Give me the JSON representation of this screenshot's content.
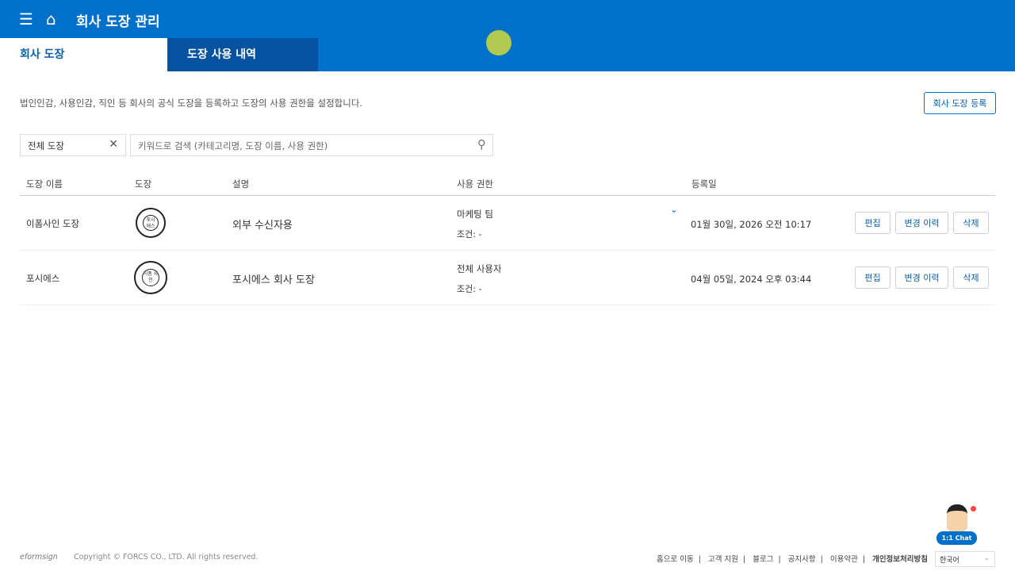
{
  "header": {
    "title": "회사 도장 관리"
  },
  "tabs": [
    {
      "label": "회사 도장"
    },
    {
      "label": "도장 사용 내역"
    }
  ],
  "description": "법인인감, 사용인감, 직인 등 회사의 공식 도장을 등록하고 도장의 사용 권한을 설정합니다.",
  "register_button": "회사 도장 등록",
  "filter": {
    "value": "전체 도장"
  },
  "search": {
    "placeholder": "키워드로 검색 (카테고리명, 도장 이름, 사용 권한)"
  },
  "columns": [
    "도장 이름",
    "도장",
    "설명",
    "사용 권한",
    "등록일"
  ],
  "rows": [
    {
      "name": "이폼사인 도장",
      "seal_text": "포시 에스",
      "description": "외부 수신자용",
      "permission": "마케팅 팀",
      "condition": "조건: -",
      "date": "01월 30일, 2026 오전 10:17"
    },
    {
      "name": "포시에스",
      "seal_text": "이폼 사인",
      "description": "포시에스 회사 도장",
      "permission": "전체 사용자",
      "condition": "조건: -",
      "date": "04월 05일, 2024 오후 03:44"
    }
  ],
  "row_actions": {
    "edit": "편집",
    "history": "변경 이력",
    "delete": "삭제"
  },
  "footer": {
    "logo": "eformsign",
    "copyright": "Copyright © FORCS CO., LTD. All rights reserved.",
    "links": [
      "홈으로 이동",
      "고객 지원",
      "블로그",
      "공지사항",
      "이용약관",
      "개인정보처리방침"
    ],
    "language": "한국어",
    "chat": "1:1 Chat"
  }
}
